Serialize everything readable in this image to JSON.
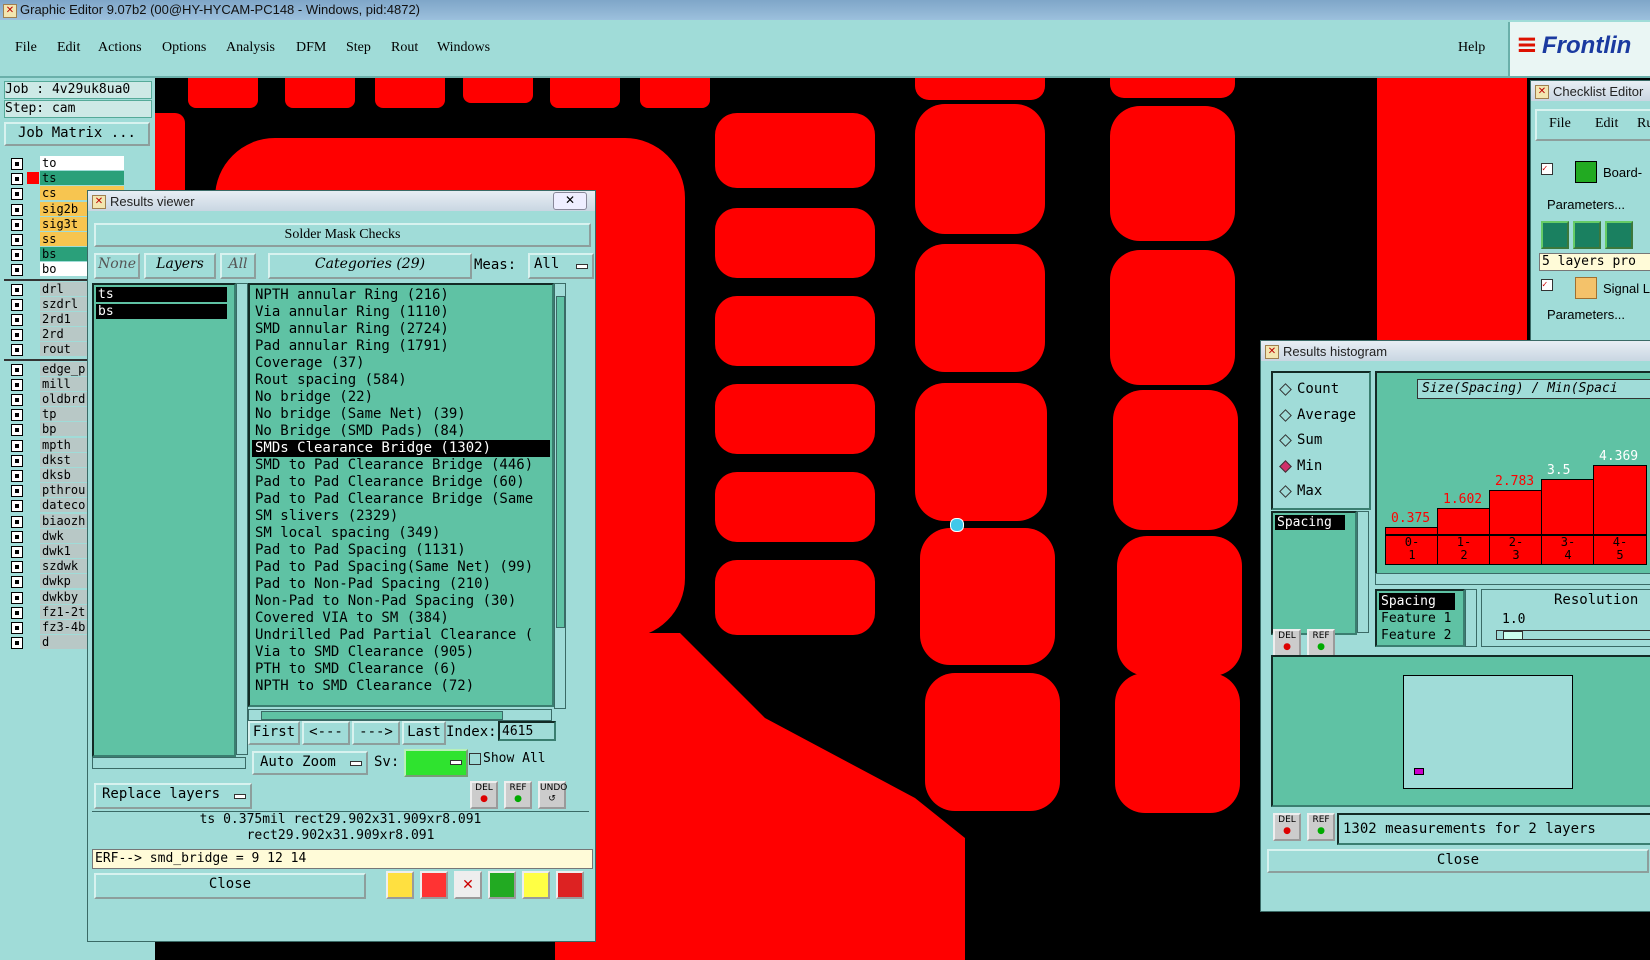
{
  "window_title": "Graphic Editor 9.07b2 (00@HY-HYCAM-PC148 - Windows, pid:4872)",
  "menu": [
    "File",
    "Edit",
    "Actions",
    "Options",
    "Analysis",
    "DFM",
    "Step",
    "Rout",
    "Windows"
  ],
  "menu_help": "Help",
  "logo_text": "Frontlin",
  "job_label": "Job : 4v29uk8ua0",
  "step_label": "Step: cam",
  "job_matrix_btn": "Job Matrix ...",
  "layers": [
    {
      "name": "to",
      "color": "#ffffff"
    },
    {
      "name": "ts",
      "color": "#2aa07a"
    },
    {
      "name": "cs",
      "color": "#f7c550"
    },
    {
      "name": "sig2b",
      "color": "#f7c550"
    },
    {
      "name": "sig3t",
      "color": "#f7c550"
    },
    {
      "name": "ss",
      "color": "#f7c550"
    },
    {
      "name": "bs",
      "color": "#2aa07a"
    },
    {
      "name": "bo",
      "color": "#ffffff"
    },
    {
      "name": "drl",
      "color": "#b8c8c6"
    },
    {
      "name": "szdrl",
      "color": "#b8c8c6"
    },
    {
      "name": "2rd1",
      "color": "#b8c8c6"
    },
    {
      "name": "2rd",
      "color": "#b8c8c6"
    },
    {
      "name": "rout",
      "color": "#b8c8c6"
    },
    {
      "name": "edge_p",
      "color": "#b8c8c6"
    },
    {
      "name": "mill",
      "color": "#b8c8c6"
    },
    {
      "name": "oldbrd",
      "color": "#b8c8c6"
    },
    {
      "name": "tp",
      "color": "#b8c8c6"
    },
    {
      "name": "bp",
      "color": "#b8c8c6"
    },
    {
      "name": "mpth",
      "color": "#b8c8c6"
    },
    {
      "name": "dkst",
      "color": "#b8c8c6"
    },
    {
      "name": "dksb",
      "color": "#b8c8c6"
    },
    {
      "name": "pthrou",
      "color": "#b8c8c6"
    },
    {
      "name": "dateco",
      "color": "#b8c8c6"
    },
    {
      "name": "biaozh",
      "color": "#b8c8c6"
    },
    {
      "name": "dwk",
      "color": "#b8c8c6"
    },
    {
      "name": "dwk1",
      "color": "#b8c8c6"
    },
    {
      "name": "szdwk",
      "color": "#b8c8c6"
    },
    {
      "name": "dwkp",
      "color": "#b8c8c6"
    },
    {
      "name": "dwkby",
      "color": "#b8c8c6"
    },
    {
      "name": "fz1-2t",
      "color": "#b8c8c6"
    },
    {
      "name": "fz3-4b",
      "color": "#b8c8c6"
    },
    {
      "name": "d",
      "color": "#b8c8c6"
    }
  ],
  "results_viewer": {
    "title": "Results viewer",
    "header": "Solder Mask Checks",
    "btn_none": "None",
    "btn_layers": "Layers",
    "btn_all": "All",
    "btn_categories": "Categories (29)",
    "meas_label": "Meas:",
    "meas_value": "All",
    "layer_items": [
      "ts",
      "bs"
    ],
    "categories": [
      "NPTH annular Ring (216)",
      "Via annular Ring (1110)",
      "SMD annular Ring (2724)",
      "Pad annular Ring (1791)",
      "Coverage (37)",
      "Rout spacing (584)",
      "No bridge (22)",
      "No bridge (Same Net) (39)",
      "No Bridge (SMD Pads) (84)",
      "SMDs Clearance Bridge (1302)",
      "SMD to Pad Clearance Bridge (446)",
      "Pad to Pad Clearance Bridge (60)",
      "Pad to Pad Clearance Bridge (Same",
      "SM slivers (2329)",
      "SM local spacing (349)",
      "Pad to Pad Spacing (1131)",
      "Pad to Pad Spacing(Same Net) (99)",
      "Pad to Non-Pad Spacing (210)",
      "Non-Pad to Non-Pad Spacing (30)",
      "Covered VIA to SM (384)",
      "Undrilled Pad Partial Clearance (",
      "Via to SMD Clearance (905)",
      "PTH to SMD Clearance (6)",
      "NPTH to SMD Clearance (72)"
    ],
    "selected_index": 9,
    "btn_first": "First",
    "btn_prev": "<---",
    "btn_next": "--->",
    "btn_last": "Last",
    "index_label": "Index:",
    "index_value": "4615",
    "btn_auto_zoom": "Auto Zoom",
    "sv_label": "Sv:",
    "show_all": "Show All",
    "btn_replace_layers": "Replace layers",
    "info_line1": "ts 0.375mil  rect29.902x31.909xr8.091",
    "info_line2": "rect29.902x31.909xr8.091",
    "erf_line": "ERF--> smd_bridge = 9 12 14",
    "btn_close": "Close",
    "icon_del": "DEL",
    "icon_ref": "REF",
    "icon_undo": "UNDO"
  },
  "checklist_editor": {
    "title": "Checklist Editor",
    "menu": [
      "File",
      "Edit",
      "Ru"
    ],
    "row1": "Board-",
    "params": "Parameters...",
    "layers_info": "5 layers pro",
    "row2": "Signal L",
    "params2": "Parameters..."
  },
  "histogram": {
    "title": "Results histogram",
    "radio_options": [
      "Count",
      "Average",
      "Sum",
      "Min",
      "Max"
    ],
    "radio_selected": "Min",
    "expression": "Size(Spacing) / Min(Spaci",
    "left_list": [
      "Spacing"
    ],
    "bars": [
      {
        "label": "0-\n1",
        "value": 0.375
      },
      {
        "label": "1-\n2",
        "value": 1.602
      },
      {
        "label": "2-\n3",
        "value": 2.783
      },
      {
        "label": "3-\n4",
        "value": 3.5
      },
      {
        "label": "4-\n5",
        "value": 4.369
      }
    ],
    "bar_value_labels": [
      "0.375",
      "1.602",
      "2.783",
      "3.5",
      "4.369"
    ],
    "bar_colors": [
      "#ff0000",
      "#ff0000",
      "#ff0000",
      "#ffffff",
      "#ffffff"
    ],
    "feature_list": [
      "Spacing",
      "Feature 1",
      "Feature 2"
    ],
    "resolution_label": "Resolution",
    "resolution_value": "1.0",
    "status": "1302 measurements for 2 layers",
    "btn_close": "Close",
    "icon_del": "DEL",
    "icon_ref": "REF"
  }
}
